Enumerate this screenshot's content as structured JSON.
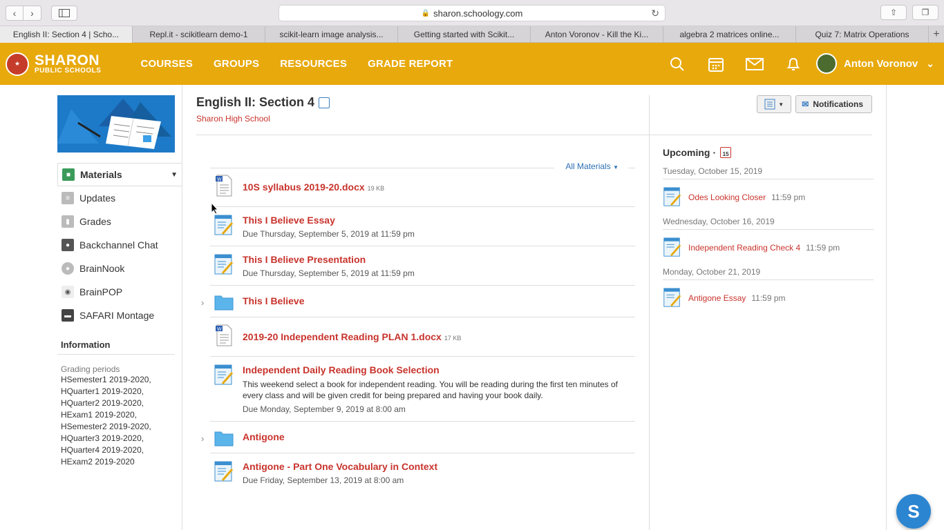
{
  "browser": {
    "url": "sharon.schoology.com",
    "tabs": [
      {
        "label": "English II: Section 4 | Scho..."
      },
      {
        "label": "Repl.it - scikitlearn demo-1"
      },
      {
        "label": "scikit-learn image analysis..."
      },
      {
        "label": "Getting started with Scikit..."
      },
      {
        "label": "Anton Voronov - Kill the Ki..."
      },
      {
        "label": "algebra 2 matrices online..."
      },
      {
        "label": "Quiz 7: Matrix Operations"
      }
    ],
    "new_tab": "+"
  },
  "header": {
    "logo_line1": "SHARON",
    "logo_line2": "PUBLIC SCHOOLS",
    "nav": [
      "COURSES",
      "GROUPS",
      "RESOURCES",
      "GRADE REPORT"
    ],
    "user_name": "Anton Voronov"
  },
  "sidebar": {
    "items": [
      {
        "label": "Materials"
      },
      {
        "label": "Updates"
      },
      {
        "label": "Grades"
      },
      {
        "label": "Backchannel Chat"
      },
      {
        "label": "BrainNook"
      },
      {
        "label": "BrainPOP"
      },
      {
        "label": "SAFARI Montage"
      }
    ],
    "info_title": "Information",
    "grading_label": "Grading periods",
    "grading_periods": [
      "HSemester1 2019-2020,",
      "HQuarter1 2019-2020,",
      "HQuarter2 2019-2020,",
      "HExam1 2019-2020,",
      "HSemester2 2019-2020,",
      "HQuarter3 2019-2020,",
      "HQuarter4 2019-2020,",
      "HExam2 2019-2020"
    ]
  },
  "main": {
    "course_title": "English II: Section 4",
    "school": "Sharon High School",
    "notifications_label": "Notifications",
    "filter_label": "All Materials",
    "materials": [
      {
        "type": "doc",
        "title": "10S syllabus 2019-20.docx",
        "size": "19 KB"
      },
      {
        "type": "assignment",
        "title": "This I Believe Essay",
        "due": "Due Thursday, September 5, 2019 at 11:59 pm"
      },
      {
        "type": "assignment",
        "title": "This I Believe Presentation",
        "due": "Due Thursday, September 5, 2019 at 11:59 pm"
      },
      {
        "type": "folder",
        "title": "This I Believe"
      },
      {
        "type": "doc",
        "title": "2019-20 Independent Reading PLAN 1.docx",
        "size": "17 KB"
      },
      {
        "type": "assignment",
        "title": "Independent Daily Reading Book Selection",
        "desc": "This weekend select a book for independent reading. You will be reading during the first ten minutes of every class and will be given credit for being prepared and having your book daily.",
        "due": "Due Monday, September 9, 2019 at 8:00 am"
      },
      {
        "type": "folder",
        "title": "Antigone"
      },
      {
        "type": "assignment",
        "title": "Antigone - Part One Vocabulary in Context",
        "due": "Due Friday, September 13, 2019 at 8:00 am"
      }
    ]
  },
  "upcoming": {
    "title": "Upcoming",
    "calendar_day": "15",
    "groups": [
      {
        "date": "Tuesday, October 15, 2019",
        "name": "Odes Looking Closer",
        "time": "11:59 pm"
      },
      {
        "date": "Wednesday, October 16, 2019",
        "name": "Independent Reading Check 4",
        "time": "11:59 pm"
      },
      {
        "date": "Monday, October 21, 2019",
        "name": "Antigone Essay",
        "time": "11:59 pm"
      }
    ]
  },
  "floating_button": "S",
  "colors": {
    "header_bg": "#e8a90c",
    "link_red": "#c8332c",
    "link_blue": "#2c6fb3",
    "float_blue": "#2c85d0"
  }
}
